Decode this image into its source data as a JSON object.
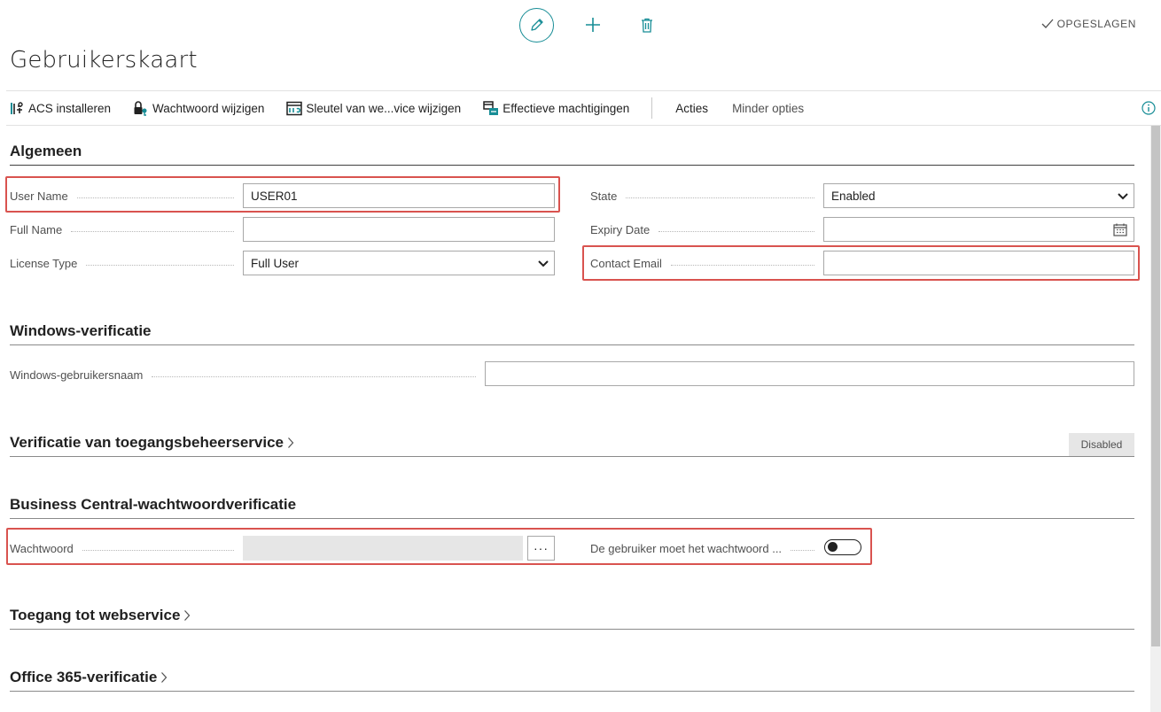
{
  "header": {
    "title": "Gebruikerskaart",
    "status": "OPGESLAGEN"
  },
  "toolbar": {
    "edit_icon": "pencil-icon",
    "new_icon": "plus-icon",
    "delete_icon": "trash-icon"
  },
  "actions": {
    "items": [
      {
        "label": "ACS installeren",
        "icon": "acs-setup-icon"
      },
      {
        "label": "Wachtwoord wijzigen",
        "icon": "key-password-icon"
      },
      {
        "label": "Sleutel van we...vice wijzigen",
        "icon": "webservice-key-icon"
      },
      {
        "label": "Effectieve machtigingen",
        "icon": "permissions-icon"
      }
    ],
    "more": "Acties",
    "fewer": "Minder opties"
  },
  "sections": {
    "general": {
      "title": "Algemeen",
      "user_name_label": "User Name",
      "user_name_value": "USER01",
      "full_name_label": "Full Name",
      "full_name_value": "",
      "license_type_label": "License Type",
      "license_type_value": "Full User",
      "state_label": "State",
      "state_value": "Enabled",
      "expiry_label": "Expiry Date",
      "expiry_value": "",
      "contact_email_label": "Contact Email",
      "contact_email_value": ""
    },
    "windows": {
      "title": "Windows-verificatie",
      "username_label": "Windows-gebruikersnaam",
      "username_value": ""
    },
    "acs": {
      "title": "Verificatie van toegangsbeheerservice",
      "status": "Disabled"
    },
    "bc_password": {
      "title": "Business Central-wachtwoordverificatie",
      "password_label": "Wachtwoord",
      "password_value": "",
      "assist_label": "···",
      "change_label": "De gebruiker moet het wachtwoord ...",
      "change_value": false
    },
    "webservice": {
      "title": "Toegang tot webservice"
    },
    "office365": {
      "title": "Office 365-verificatie"
    }
  },
  "colors": {
    "accent": "#178d96",
    "highlight": "#d9534f"
  }
}
